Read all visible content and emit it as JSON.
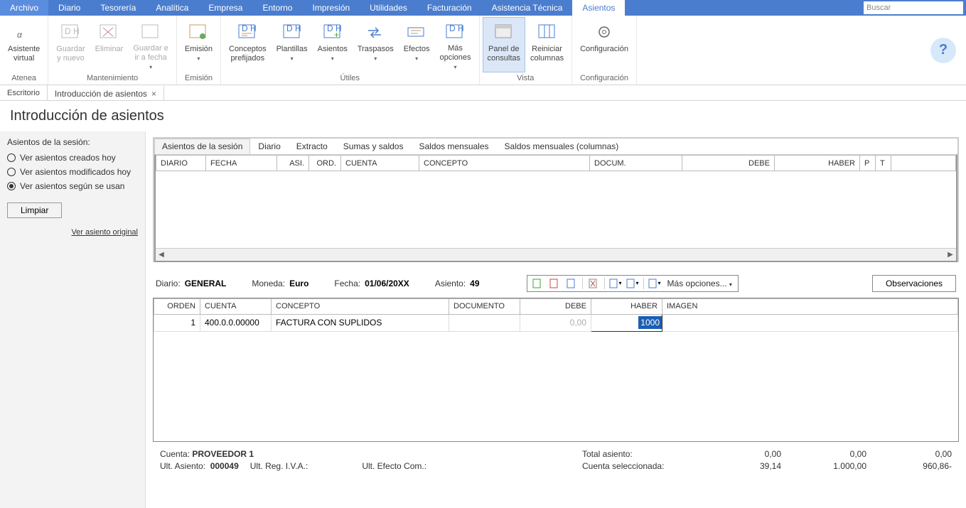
{
  "menubar": {
    "items": [
      "Archivo",
      "Diario",
      "Tesorería",
      "Analítica",
      "Empresa",
      "Entorno",
      "Impresión",
      "Utilidades",
      "Facturación",
      "Asistencia Técnica",
      "Asientos"
    ],
    "active_index": 10,
    "search_placeholder": "Buscar"
  },
  "ribbon": {
    "groups": [
      {
        "label": "Atenea",
        "buttons": [
          {
            "label": "Asistente\nvirtual",
            "icon": "alpha",
            "dd": false
          }
        ]
      },
      {
        "label": "Mantenimiento",
        "buttons": [
          {
            "label": "Guardar\ny nuevo",
            "icon": "save-new",
            "disabled": true
          },
          {
            "label": "Eliminar",
            "icon": "delete",
            "disabled": true
          },
          {
            "label": "Guardar e\nir a fecha",
            "icon": "save-date",
            "disabled": true,
            "dd": true
          }
        ]
      },
      {
        "label": "Emisión",
        "buttons": [
          {
            "label": "Emisión",
            "icon": "emit",
            "dd": true
          }
        ]
      },
      {
        "label": "Útiles",
        "buttons": [
          {
            "label": "Conceptos\nprefijados",
            "icon": "concepts"
          },
          {
            "label": "Plantillas",
            "icon": "templates",
            "dd": true
          },
          {
            "label": "Asientos",
            "icon": "asientos",
            "dd": true
          },
          {
            "label": "Traspasos",
            "icon": "transfers",
            "dd": true
          },
          {
            "label": "Efectos",
            "icon": "effects",
            "dd": true
          },
          {
            "label": "Más\nopciones",
            "icon": "more",
            "dd": true
          }
        ]
      },
      {
        "label": "Vista",
        "buttons": [
          {
            "label": "Panel de\nconsultas",
            "icon": "panel",
            "active": true
          },
          {
            "label": "Reiniciar\ncolumnas",
            "icon": "reset-cols"
          }
        ]
      },
      {
        "label": "Configuración",
        "buttons": [
          {
            "label": "Configuración",
            "icon": "gear"
          }
        ]
      }
    ]
  },
  "ws_tabs": [
    {
      "label": "Escritorio",
      "closable": false
    },
    {
      "label": "Introducción de asientos",
      "closable": true,
      "active": true
    }
  ],
  "page_title": "Introducción de asientos",
  "sidebar": {
    "title": "Asientos de la sesión:",
    "radios": [
      {
        "label": "Ver asientos creados hoy",
        "selected": false
      },
      {
        "label": "Ver asientos modificados hoy",
        "selected": false
      },
      {
        "label": "Ver asientos según se usan",
        "selected": true
      }
    ],
    "clear_btn": "Limpiar",
    "view_original": "Ver asiento original"
  },
  "inner_tabs": [
    "Asientos de la sesión",
    "Diario",
    "Extracto",
    "Sumas y saldos",
    "Saldos mensuales",
    "Saldos mensuales (columnas)"
  ],
  "inner_tab_active": 0,
  "session_headers": [
    "DIARIO",
    "FECHA",
    "ASI.",
    "ORD.",
    "CUENTA",
    "CONCEPTO",
    "DOCUM.",
    "DEBE",
    "HABER",
    "P",
    "T",
    ""
  ],
  "info": {
    "diario_lbl": "Diario:",
    "diario_val": "GENERAL",
    "moneda_lbl": "Moneda:",
    "moneda_val": "Euro",
    "fecha_lbl": "Fecha:",
    "fecha_val": "01/06/20XX",
    "asiento_lbl": "Asiento:",
    "asiento_val": "49",
    "more_options": "Más opciones...",
    "obs_btn": "Observaciones"
  },
  "entry": {
    "headers": [
      "ORDEN",
      "CUENTA",
      "CONCEPTO",
      "DOCUMENTO",
      "DEBE",
      "HABER",
      "IMAGEN"
    ],
    "row": {
      "orden": "1",
      "cuenta": "400.0.0.00000",
      "concepto": "FACTURA CON SUPLIDOS",
      "documento": "",
      "debe": "0,00",
      "haber": "1000",
      "imagen": ""
    }
  },
  "footer": {
    "cuenta_lbl": "Cuenta:",
    "cuenta_val": "PROVEEDOR 1",
    "ult_asiento_lbl": "Ult. Asiento:",
    "ult_asiento_val": "000049",
    "ult_reg_lbl": "Ult. Reg. I.V.A.:",
    "ult_reg_val": "",
    "ult_efecto_lbl": "Ult. Efecto Com.:",
    "ult_efecto_val": "",
    "total_lbl": "Total asiento:",
    "total_vals": [
      "0,00",
      "0,00",
      "0,00"
    ],
    "sel_lbl": "Cuenta seleccionada:",
    "sel_vals": [
      "39,14",
      "1.000,00",
      "960,86-"
    ]
  }
}
